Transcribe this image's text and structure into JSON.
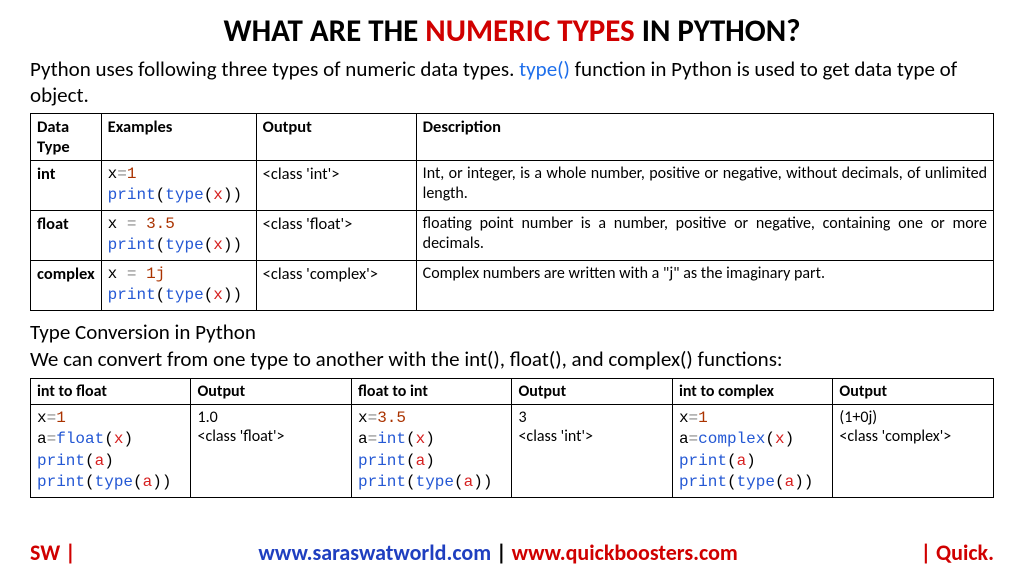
{
  "title": {
    "pre": "WHAT ARE THE ",
    "mid": "NUMERIC TYPES",
    "post": " IN PYTHON?"
  },
  "intro": {
    "pre": "Python uses following three types of numeric data types. ",
    "fn": "type()",
    "post": " function in Python is used to get data type of object."
  },
  "table1": {
    "headers": [
      "Data Type",
      "Examples",
      "Output",
      "Description"
    ],
    "rows": [
      {
        "type": "int",
        "code": {
          "l1_var": "x",
          "l1_eq": "=",
          "l1_num": "1",
          "l2_fn": "print",
          "l2_in": "type",
          "l2_arg": "x"
        },
        "output": "<class 'int'>",
        "desc": "Int, or integer, is a whole number, positive or negative, without decimals, of unlimited length."
      },
      {
        "type": "float",
        "code": {
          "l1_var": "x",
          "l1_eq": " = ",
          "l1_num": "3.5",
          "l2_fn": "print",
          "l2_in": "type",
          "l2_arg": "x"
        },
        "output": "<class 'float'>",
        "desc": "floating point number is a number, positive or negative, containing one or more decimals."
      },
      {
        "type": "complex",
        "code": {
          "l1_var": "x",
          "l1_eq": " = ",
          "l1_num": "1j",
          "l2_fn": "print",
          "l2_in": "type",
          "l2_arg": "x"
        },
        "output": "<class 'complex'>",
        "desc": "Complex numbers are written with a \"j\" as the imaginary part."
      }
    ]
  },
  "sub": {
    "h": "Type Conversion in Python",
    "p": "We can convert from one type to another with the int(), float(), and complex() functions:"
  },
  "table2": {
    "headers": [
      "int to float",
      "Output",
      "float to int",
      "Output",
      "int to complex",
      "Output"
    ],
    "cells": {
      "c0": {
        "l1v": "x",
        "l1e": "=",
        "l1n": "1",
        "l2v": "a",
        "l2e": "=",
        "l2f": "float",
        "l2a": "x",
        "l3f": "print",
        "l3a": "a",
        "l4f": "print",
        "l4i": "type",
        "l4a": "a"
      },
      "o0": {
        "l1": "1.0",
        "l2": "<class 'float'>"
      },
      "c1": {
        "l1v": "x",
        "l1e": "=",
        "l1n": "3.5",
        "l2v": "a",
        "l2e": "=",
        "l2f": "int",
        "l2a": "x",
        "l3f": "print",
        "l3a": "a",
        "l4f": "print",
        "l4i": "type",
        "l4a": "a"
      },
      "o1": {
        "l1": "3",
        "l2": "<class 'int'>"
      },
      "c2": {
        "l1v": "x",
        "l1e": "=",
        "l1n": "1",
        "l2v": "a",
        "l2e": "=",
        "l2f": "complex",
        "l2a": "x",
        "l3f": "print",
        "l3a": "a",
        "l4f": "print",
        "l4i": "type",
        "l4a": "a"
      },
      "o2": {
        "l1": "(1+0j)",
        "l2": "<class 'complex'>"
      }
    }
  },
  "footer": {
    "left": "SW |",
    "mid_blue": "www.saraswatworld.com",
    "mid_sep": " | ",
    "mid_red": "www.quickboosters.com",
    "right": "| Quick."
  }
}
